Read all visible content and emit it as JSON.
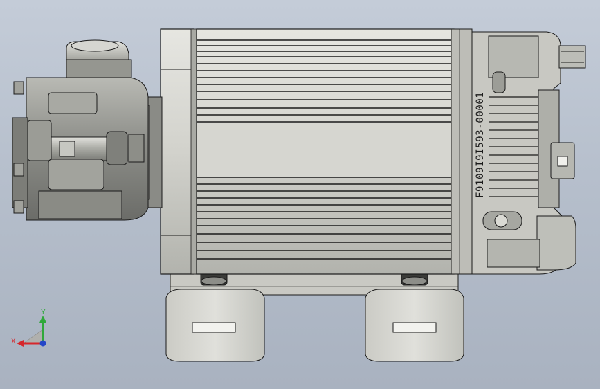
{
  "viewport": {
    "background_top": "#c4ccd8",
    "background_bottom": "#a9b2c0"
  },
  "model": {
    "part_number": "F9109I9I593-00001",
    "body_color": "#cfcfc9",
    "shadow_color": "#6f706c",
    "edge_color": "#1a1a1a"
  },
  "triad": {
    "x_label": "X",
    "y_label": "Y",
    "x_color": "#d6262b",
    "y_color": "#2fa83a",
    "z_color": "#2446c8"
  }
}
